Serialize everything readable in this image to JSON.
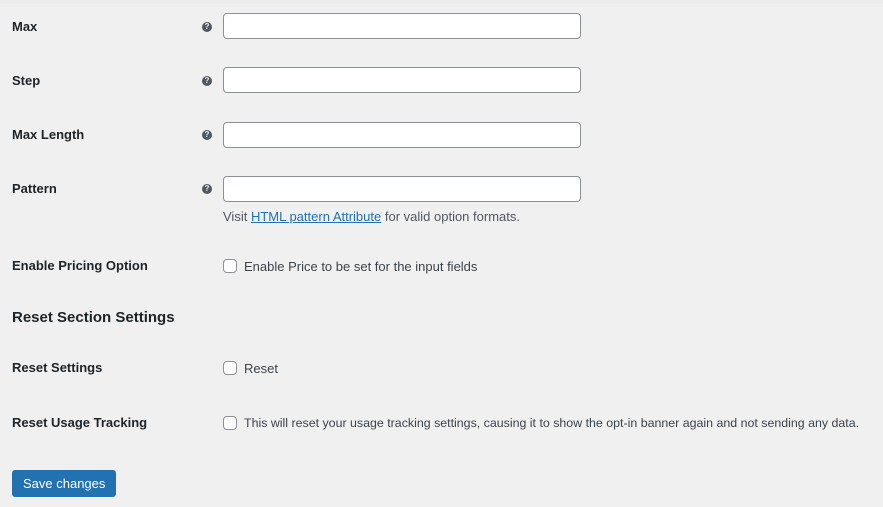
{
  "fields": [
    {
      "label": "Max",
      "help_icon": "question-circle-icon",
      "value": "",
      "placeholder": ""
    },
    {
      "label": "Step",
      "help_icon": "question-circle-icon",
      "value": "",
      "placeholder": ""
    },
    {
      "label": "Max Length",
      "help_icon": "question-circle-icon",
      "value": "",
      "placeholder": ""
    },
    {
      "label": "Pattern",
      "help_icon": "question-circle-icon",
      "value": "",
      "placeholder": ""
    }
  ],
  "pattern_description": {
    "prefix": "Visit ",
    "link_text": "HTML pattern Attribute",
    "suffix": " for valid option formats."
  },
  "pricing": {
    "label": "Enable Pricing Option",
    "checkbox_label": "Enable Price to be set for the input fields",
    "checked": false
  },
  "reset_section": {
    "title": "Reset Section Settings",
    "reset_settings": {
      "label": "Reset Settings",
      "checkbox_label": "Reset",
      "checked": false
    },
    "reset_tracking": {
      "label": "Reset Usage Tracking",
      "checkbox_label": "This will reset your usage tracking settings, causing it to show the opt-in banner again and not sending any data.",
      "checked": false
    }
  },
  "save_button": {
    "label": "Save changes"
  },
  "colors": {
    "accent": "#2271b1",
    "background": "#f0f0f1",
    "text": "#1d2327"
  }
}
